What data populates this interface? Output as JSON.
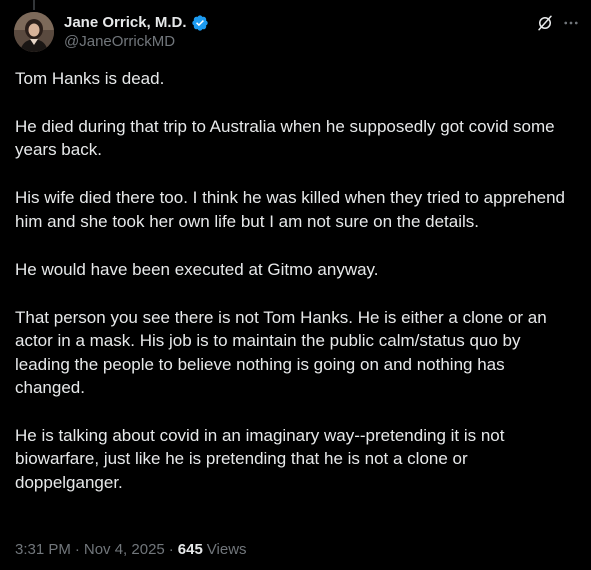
{
  "author": {
    "display_name": "Jane Orrick, M.D.",
    "handle": "@JaneOrrickMD",
    "verified": true,
    "verified_color": "#1d9bf0"
  },
  "icons": {
    "verified": "verified-badge-icon",
    "grok": "grok-icon",
    "more": "more-horizontal-icon"
  },
  "tweet": {
    "paragraphs": [
      "Tom Hanks is dead.",
      "He died during that trip to Australia when he supposedly got covid some years back.",
      "His wife died there too.  I think he was killed when they tried to apprehend him and she took her own life but I am not sure on the details.",
      "He would have been executed at Gitmo anyway.",
      "That person you see there is not Tom Hanks.  He is either a clone or an actor in a mask.  His job is to maintain the public calm/status quo by leading the people to believe nothing is going on and nothing has changed.",
      "He is talking about covid in an imaginary way--pretending it is not biowarfare, just like he is pretending that he is not a clone or doppelganger."
    ]
  },
  "meta": {
    "time": "3:31 PM",
    "separator": "·",
    "date": "Nov 4, 2025",
    "separator2": "·",
    "views_count": "645",
    "views_label": "Views"
  },
  "colors": {
    "background": "#000000",
    "text_primary": "#e7e9ea",
    "text_secondary": "#71767b"
  }
}
